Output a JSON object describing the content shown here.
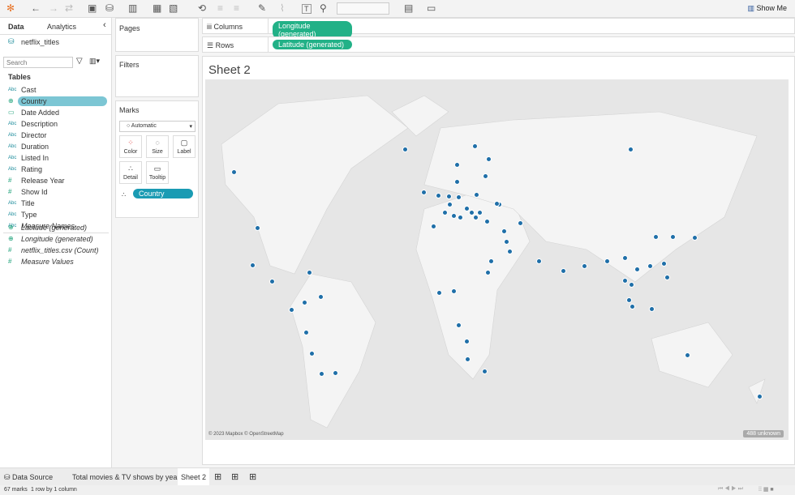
{
  "toolbar": {
    "show_me": "Show Me"
  },
  "data_pane": {
    "tabs": [
      "Data",
      "Analytics"
    ],
    "datasource": "netflix_titles",
    "search_placeholder": "Search",
    "tables_heading": "Tables",
    "fields": [
      {
        "type": "Abc",
        "name": "Cast"
      },
      {
        "type": "globe",
        "name": "Country",
        "selected": true
      },
      {
        "type": "date",
        "name": "Date Added"
      },
      {
        "type": "Abc",
        "name": "Description"
      },
      {
        "type": "Abc",
        "name": "Director"
      },
      {
        "type": "Abc",
        "name": "Duration"
      },
      {
        "type": "Abc",
        "name": "Listed In"
      },
      {
        "type": "Abc",
        "name": "Rating"
      },
      {
        "type": "#",
        "name": "Release Year"
      },
      {
        "type": "#",
        "name": "Show Id"
      },
      {
        "type": "Abc",
        "name": "Title"
      },
      {
        "type": "Abc",
        "name": "Type"
      },
      {
        "type": "Abc",
        "name": "Measure Names"
      }
    ],
    "measures": [
      {
        "type": "globe",
        "name": "Latitude (generated)"
      },
      {
        "type": "globe",
        "name": "Longitude (generated)"
      },
      {
        "type": "#",
        "name": "netflix_titles.csv (Count)"
      },
      {
        "type": "#",
        "name": "Measure Values"
      }
    ]
  },
  "shelves": {
    "pages": "Pages",
    "filters": "Filters",
    "marks": "Marks",
    "mark_type": "Automatic",
    "buttons": [
      "Color",
      "Size",
      "Label",
      "Detail",
      "Tooltip"
    ],
    "detail_pill": "Country",
    "columns_label": "Columns",
    "columns_pill": "Longitude (generated)",
    "rows_label": "Rows",
    "rows_pill": "Latitude (generated)"
  },
  "sheet": {
    "title": "Sheet 2",
    "attribution": "© 2023 Mapbox © OpenStreetMap",
    "unknown_badge": "488 unknown",
    "mark_color": "#1f6fa8"
  },
  "tabs": {
    "data_source": "Data Source",
    "sheets": [
      "Total movies & TV shows by years",
      "Sheet 2"
    ],
    "active": "Sheet 2"
  },
  "status": {
    "marks": "67 marks",
    "dims": "1 row by 1 column"
  }
}
